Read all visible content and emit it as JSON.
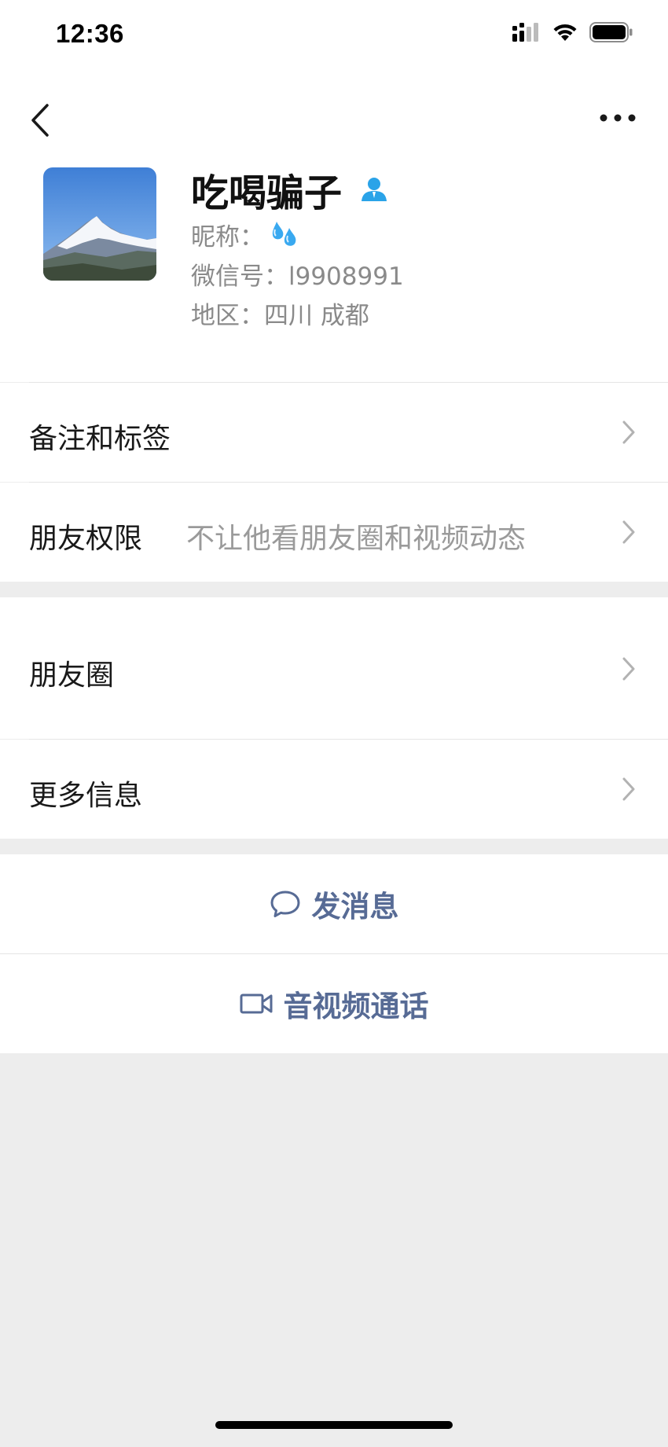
{
  "status": {
    "time": "12:36"
  },
  "profile": {
    "name": "吃喝骗子",
    "nickname_label": "昵称：",
    "wechat_id": "微信号：l9908991",
    "region": "地区：四川 成都"
  },
  "rows": {
    "remark": "备注和标签",
    "permissions_label": "朋友权限",
    "permissions_value": "不让他看朋友圈和视频动态",
    "moments": "朋友圈",
    "more_info": "更多信息"
  },
  "actions": {
    "message": "发消息",
    "call": "音视频通话"
  },
  "colors": {
    "link": "#576b95",
    "background": "#ededed"
  }
}
